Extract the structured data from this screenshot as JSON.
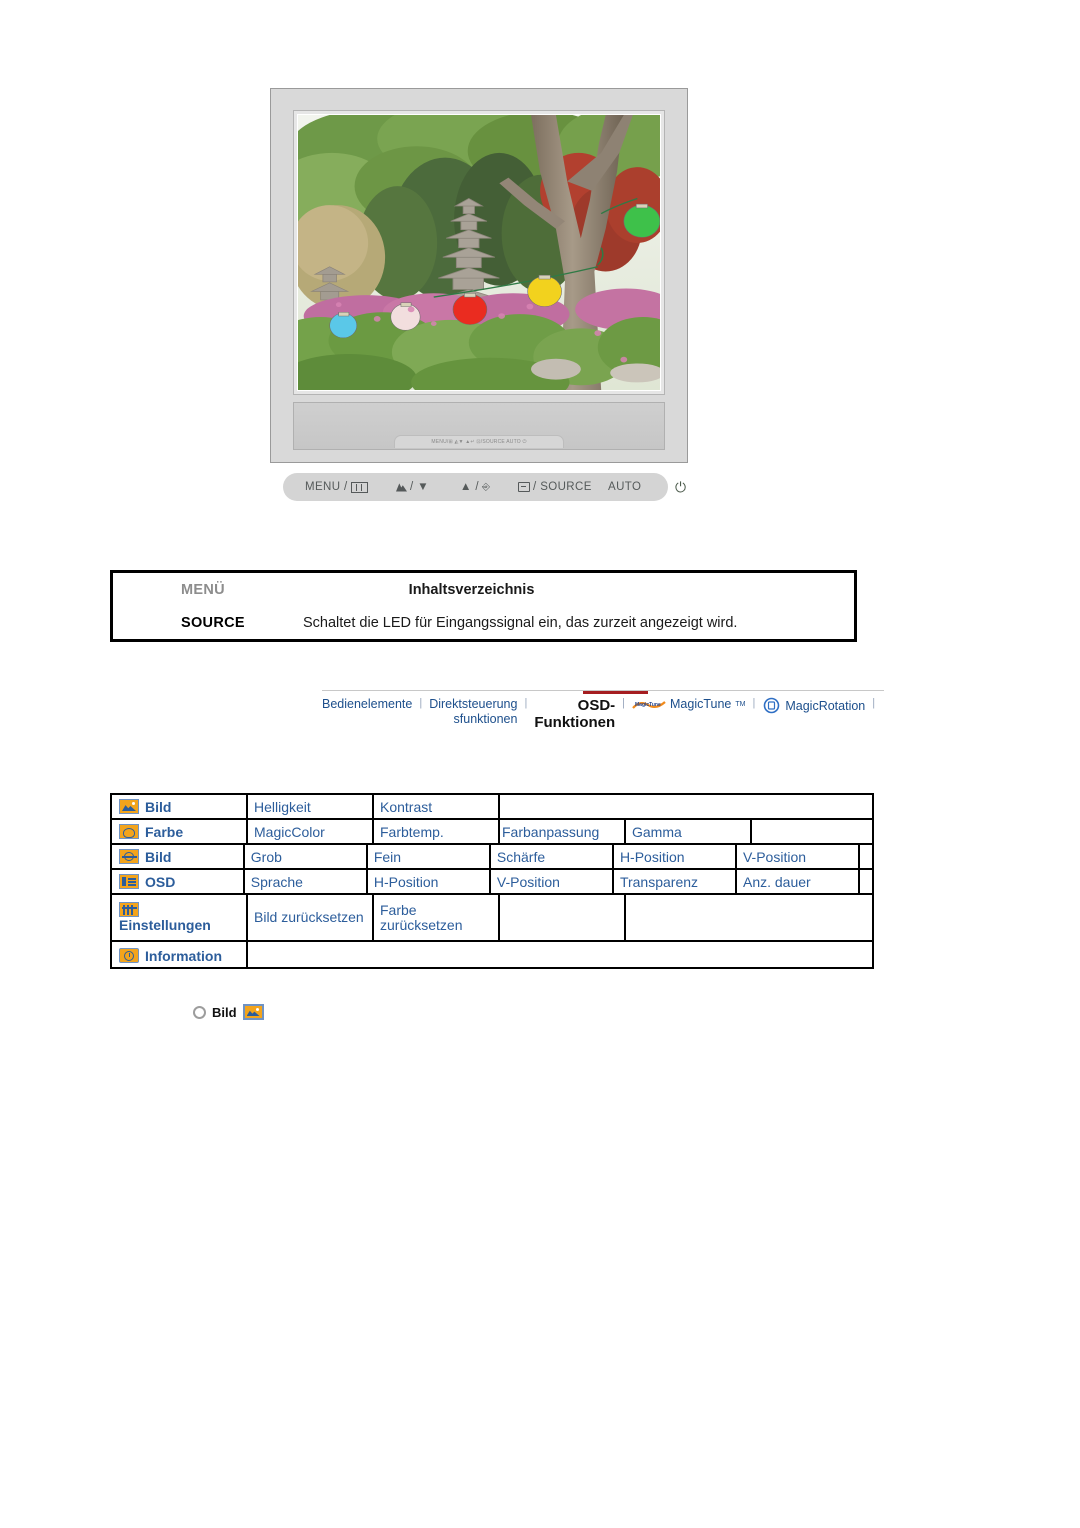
{
  "monitor": {
    "alt_label": "lcd-monitor-front-view",
    "screen_scene": "garden-with-stone-pagoda-and-paper-lanterns",
    "chin_strip_labels": "MENU/⊞  ◭▼  ▲↵  ⊡/SOURCE  AUTO  ⏻"
  },
  "control_bar": {
    "items": [
      {
        "name": "menu-button-label",
        "text": "MENU /",
        "icon": "menu-bars-icon"
      },
      {
        "name": "brightness-down-button-label",
        "text": "/ ▼",
        "icon": "brightness-icon"
      },
      {
        "name": "up-enter-button-label",
        "text": "▲ /",
        "icon": "enter-icon"
      },
      {
        "name": "source-button-label",
        "text": "/ SOURCE",
        "icon": "source-icon"
      },
      {
        "name": "auto-button-label",
        "text": "AUTO",
        "icon": ""
      },
      {
        "name": "power-button-label",
        "text": "",
        "icon": "power-icon"
      }
    ]
  },
  "menu_table": {
    "header": {
      "key": "MENÜ",
      "value": "Inhaltsverzeichnis"
    },
    "rows": [
      {
        "key": "SOURCE",
        "value": "Schaltet die LED für Eingangssignal ein, das zurzeit angezeigt wird."
      }
    ]
  },
  "nav": {
    "tabs": [
      {
        "label": "Bedienelemente",
        "active": false
      },
      {
        "label_line1": "Direktsteuerung",
        "label_line2": "sfunktionen",
        "active": false
      },
      {
        "label_line1": "OSD-",
        "label_line2": "Funktionen",
        "active": true
      },
      {
        "label": "MagicTune",
        "tm": "TM",
        "active": false,
        "logo": "magictune-logo"
      },
      {
        "label": "MagicRotation",
        "active": false,
        "logo": "magicrotation-logo"
      }
    ],
    "separator": "|",
    "active_color": "#a51d20"
  },
  "osd_table": {
    "rows": [
      {
        "icon": "picture-icon",
        "label": "Bild",
        "items": [
          "Helligkeit",
          "Kontrast"
        ]
      },
      {
        "icon": "color-icon",
        "label": "Farbe",
        "items": [
          "MagicColor",
          "Farbtemp.",
          "Farbanpassung",
          "Gamma"
        ]
      },
      {
        "icon": "image-icon",
        "label": "Bild",
        "items": [
          "Grob",
          "Fein",
          "Schärfe",
          "H-Position",
          "V-Position"
        ]
      },
      {
        "icon": "osd-icon",
        "label": "OSD",
        "items": [
          "Sprache",
          "H-Position",
          "V-Position",
          "Transparenz",
          "Anz. dauer"
        ]
      },
      {
        "icon": "setup-icon",
        "label": "Einstellungen",
        "items": [
          "Bild zurücksetzen",
          "Farbe zurücksetzen"
        ]
      },
      {
        "icon": "information-icon",
        "label": "Information",
        "items": []
      }
    ]
  },
  "section": {
    "bullet": "hex-bullet-icon",
    "title": "Bild",
    "icon": "picture-icon"
  },
  "colors": {
    "link_blue": "#2c5d9b",
    "nav_blue": "#1d4f8c",
    "accent_red": "#a51d20",
    "icon_orange": "#f3a41c"
  }
}
